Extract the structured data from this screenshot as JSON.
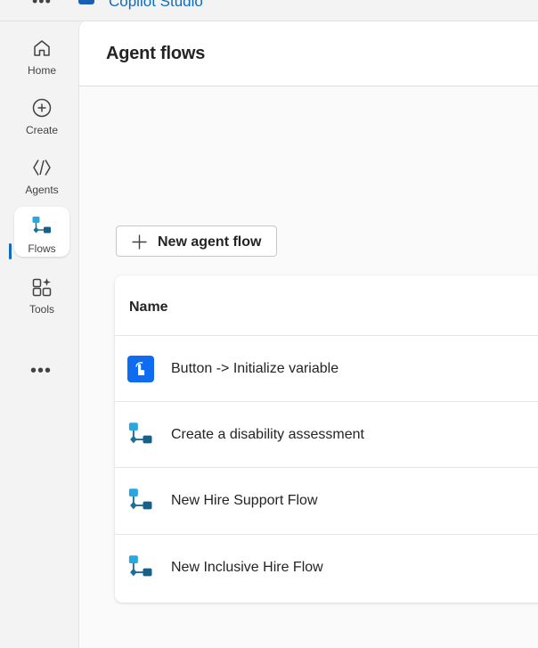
{
  "app": {
    "name": "Copilot Studio",
    "brand_color": "#0f6cbd"
  },
  "nav": {
    "items": [
      {
        "label": "Home",
        "icon": "home-icon"
      },
      {
        "label": "Create",
        "icon": "add-circle-icon"
      },
      {
        "label": "Agents",
        "icon": "agents-icon"
      },
      {
        "label": "Flows",
        "icon": "flow-icon",
        "active": true
      },
      {
        "label": "Tools",
        "icon": "tools-icon"
      }
    ],
    "more_label": "•••"
  },
  "page": {
    "title": "Agent flows"
  },
  "toolbar": {
    "new_flow_label": "New agent flow"
  },
  "table": {
    "header": "Name",
    "rows": [
      {
        "name": "Button -> Initialize variable",
        "icon": "touch-button-icon"
      },
      {
        "name": "Create a disability assessment",
        "icon": "flow-icon"
      },
      {
        "name": "New Hire Support Flow",
        "icon": "flow-icon"
      },
      {
        "name": "New Inclusive Hire Flow",
        "icon": "flow-icon"
      }
    ]
  }
}
